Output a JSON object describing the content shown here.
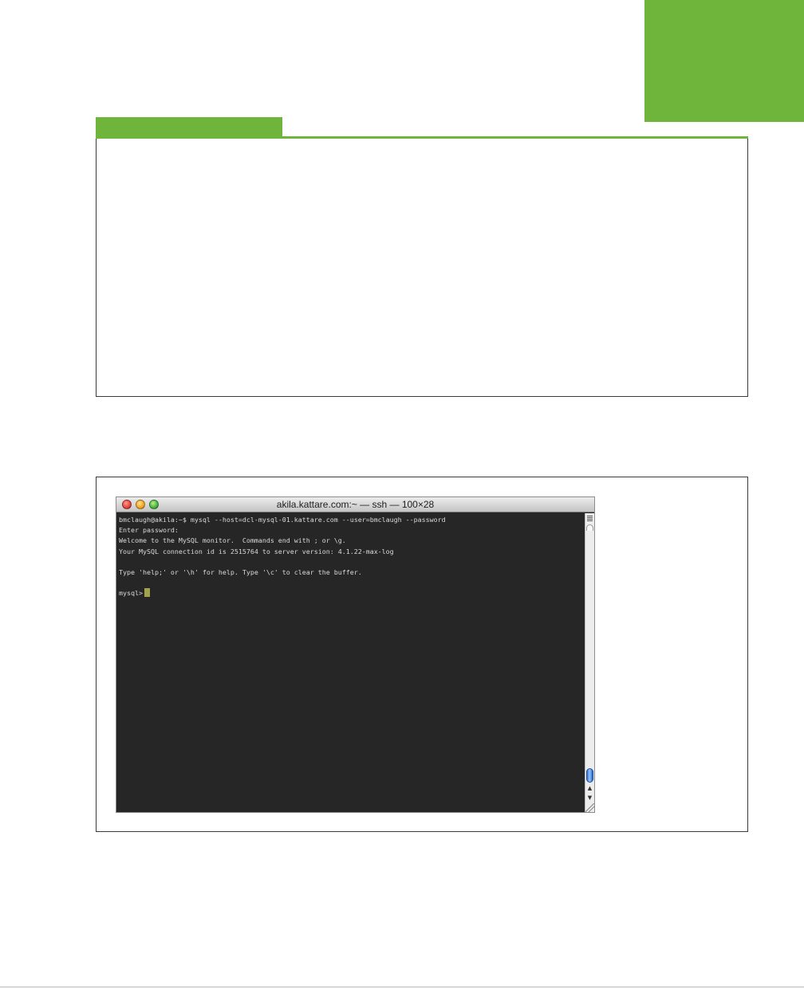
{
  "colors": {
    "accent_green": "#6fb53c",
    "terminal_background": "#262626",
    "terminal_text": "#d9d9d9",
    "cursor": "#a3a24c"
  },
  "terminal": {
    "window_title": "akila.kattare.com:~ — ssh — 100×28",
    "lines": [
      "bmclaugh@akila:~$ mysql --host=dcl-mysql-01.kattare.com --user=bmclaugh --password",
      "Enter password:",
      "Welcome to the MySQL monitor.  Commands end with ; or \\g.",
      "Your MySQL connection id is 2515764 to server version: 4.1.22-max-log",
      "",
      "Type 'help;' or '\\h' for help. Type '\\c' to clear the buffer.",
      ""
    ],
    "prompt": "mysql>"
  }
}
